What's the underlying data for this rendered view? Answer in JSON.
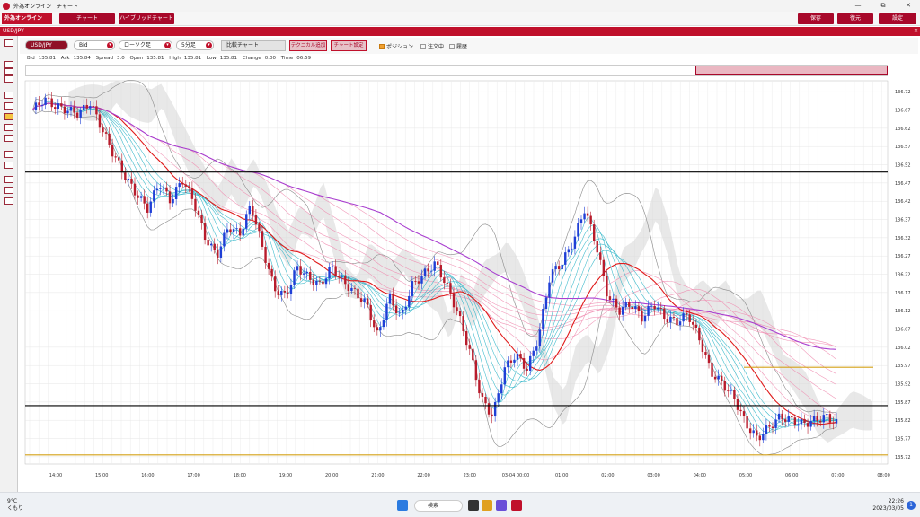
{
  "window": {
    "title": "外為オンライン　チャート",
    "min": "—",
    "restore": "⧉",
    "close": "✕"
  },
  "menubar": {
    "brand": "外為オンライン",
    "tabs": [
      "チャート",
      "ハイブリッドチャート"
    ],
    "save": "保存",
    "restore": "復元",
    "settings": "設定"
  },
  "symbol_bar": {
    "title": "USD/JPY",
    "close": "✕"
  },
  "controls": {
    "pair": "USD/JPY",
    "price_type": "Bid",
    "chart_type": "ローソク足",
    "timeframe": "5分足",
    "compare": "比較チャート",
    "add_technical": "テクニカル追加",
    "chart_settings": "チャート設定",
    "position": "ポジション",
    "orders": "注文中",
    "history": "履歴"
  },
  "quote": {
    "bid_label": "Bid",
    "bid": "135.81",
    "ask_label": "Ask",
    "ask": "135.84",
    "spread_label": "Spread",
    "spread": "3.0",
    "open_label": "Open",
    "open": "135.81",
    "high_label": "High",
    "high": "135.81",
    "low_label": "Low",
    "low": "135.81",
    "change_label": "Change",
    "change": "0.00",
    "time_label": "Time",
    "time": "06:59"
  },
  "chart_data": {
    "type": "candlestick",
    "y_ticks": [
      "136.72",
      "136.67",
      "136.62",
      "136.57",
      "136.52",
      "136.47",
      "136.42",
      "136.37",
      "136.32",
      "136.27",
      "136.22",
      "136.17",
      "136.12",
      "136.07",
      "136.02",
      "135.97",
      "135.92",
      "135.87",
      "135.82",
      "135.77",
      "135.72"
    ],
    "y_range": [
      135.7,
      136.75
    ],
    "x_ticks": [
      "14:00",
      "15:00",
      "16:00",
      "17:00",
      "18:00",
      "19:00",
      "20:00",
      "21:00",
      "22:00",
      "23:00",
      "03-04 00:00",
      "01:00",
      "02:00",
      "03:00",
      "04:00",
      "05:00",
      "06:00",
      "07:00",
      "08:00"
    ],
    "horizontal_lines": [
      {
        "value": 136.5,
        "color": "#000000"
      },
      {
        "value": 135.86,
        "color": "#000000"
      },
      {
        "value": 135.965,
        "color": "#d4a017"
      },
      {
        "value": 135.725,
        "color": "#d4a017"
      }
    ],
    "colors": {
      "up": "#1f3fd6",
      "down": "#b81c2c",
      "ma_short": "#e01a1a",
      "ma_long": "#a93fd0",
      "ribbon_fast": "#2eb5c8",
      "ribbon_slow": "#f08cb0",
      "bollinger": "#888888",
      "cloud": "#d8d8d8"
    },
    "price_path": [
      [
        "13:30",
        136.67
      ],
      [
        "13:45",
        136.7
      ],
      [
        "14:00",
        136.68
      ],
      [
        "14:30",
        136.66
      ],
      [
        "14:45",
        136.69
      ],
      [
        "15:00",
        136.62
      ],
      [
        "15:15",
        136.55
      ],
      [
        "15:30",
        136.49
      ],
      [
        "15:45",
        136.44
      ],
      [
        "16:00",
        136.4
      ],
      [
        "16:15",
        136.47
      ],
      [
        "16:30",
        136.42
      ],
      [
        "16:45",
        136.48
      ],
      [
        "17:00",
        136.42
      ],
      [
        "17:15",
        136.32
      ],
      [
        "17:30",
        136.27
      ],
      [
        "17:45",
        136.35
      ],
      [
        "18:00",
        136.33
      ],
      [
        "18:15",
        136.41
      ],
      [
        "18:30",
        136.29
      ],
      [
        "18:45",
        136.18
      ],
      [
        "19:00",
        136.16
      ],
      [
        "19:15",
        136.24
      ],
      [
        "19:30",
        136.21
      ],
      [
        "19:45",
        136.19
      ],
      [
        "20:00",
        136.24
      ],
      [
        "20:15",
        136.2
      ],
      [
        "20:30",
        136.17
      ],
      [
        "20:45",
        136.14
      ],
      [
        "21:00",
        136.05
      ],
      [
        "21:15",
        136.16
      ],
      [
        "21:30",
        136.1
      ],
      [
        "21:45",
        136.19
      ],
      [
        "22:00",
        136.22
      ],
      [
        "22:15",
        136.25
      ],
      [
        "22:30",
        136.19
      ],
      [
        "22:45",
        136.11
      ],
      [
        "23:00",
        136.01
      ],
      [
        "23:15",
        135.88
      ],
      [
        "23:30",
        135.83
      ],
      [
        "23:45",
        135.96
      ],
      [
        "00:00",
        136.0
      ],
      [
        "00:15",
        135.96
      ],
      [
        "00:30",
        136.05
      ],
      [
        "00:45",
        136.22
      ],
      [
        "01:00",
        136.25
      ],
      [
        "01:15",
        136.31
      ],
      [
        "01:30",
        136.4
      ],
      [
        "01:45",
        136.3
      ],
      [
        "02:00",
        136.16
      ],
      [
        "02:15",
        136.12
      ],
      [
        "02:30",
        136.14
      ],
      [
        "02:45",
        136.1
      ],
      [
        "03:00",
        136.14
      ],
      [
        "03:15",
        136.1
      ],
      [
        "03:30",
        136.09
      ],
      [
        "03:45",
        136.11
      ],
      [
        "04:00",
        136.04
      ],
      [
        "04:15",
        135.95
      ],
      [
        "04:30",
        135.92
      ],
      [
        "04:45",
        135.88
      ],
      [
        "05:00",
        135.81
      ],
      [
        "05:15",
        135.77
      ],
      [
        "05:30",
        135.8
      ],
      [
        "05:45",
        135.83
      ],
      [
        "06:00",
        135.82
      ],
      [
        "06:15",
        135.81
      ],
      [
        "06:30",
        135.82
      ],
      [
        "06:45",
        135.83
      ],
      [
        "07:00",
        135.81
      ]
    ]
  },
  "taskbar": {
    "temp": "9°C",
    "weather": "くもり",
    "search": "検索",
    "time": "22:26",
    "date": "2023/03/05",
    "notifications": "1"
  }
}
